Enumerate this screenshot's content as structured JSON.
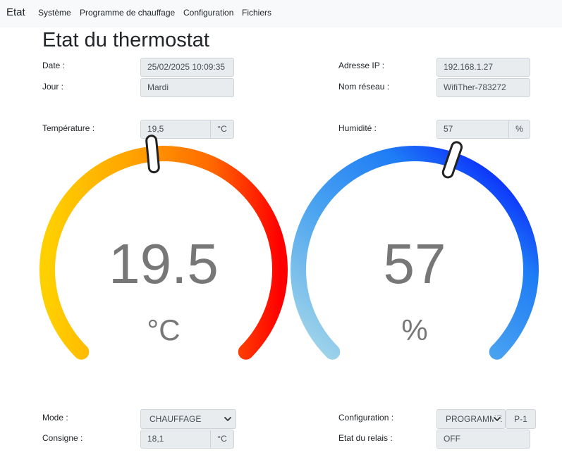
{
  "navbar": {
    "brand": "Etat",
    "items": [
      {
        "label": "Système"
      },
      {
        "label": "Programme de chauffage"
      },
      {
        "label": "Configuration"
      },
      {
        "label": "Fichiers"
      }
    ]
  },
  "page_title": "Etat du thermostat",
  "info": {
    "date_label": "Date :",
    "date_value": "25/02/2025 10:09:35",
    "day_label": "Jour :",
    "day_value": "Mardi",
    "ip_label": "Adresse IP :",
    "ip_value": "192.168.1.27",
    "network_label": "Nom réseau :",
    "network_value": "WifiTher-783272",
    "temperature_label": "Température :",
    "temperature_value": "19,5",
    "temperature_unit": "°C",
    "humidity_label": "Humidité :",
    "humidity_value": "57",
    "humidity_unit": "%"
  },
  "gauges": {
    "temperature": {
      "value_text": "19.5",
      "unit": "°C",
      "value": 19.5,
      "fraction": 0.48,
      "colors": [
        "#ffd000",
        "#ffa500",
        "#ff6a00",
        "#ff0000"
      ]
    },
    "humidity": {
      "value_text": "57",
      "unit": "%",
      "value": 57,
      "fraction": 0.57,
      "colors": [
        "#a9d9e8",
        "#4aa3f0",
        "#1e7cf5",
        "#0000ff"
      ]
    }
  },
  "controls": {
    "mode_label": "Mode :",
    "mode_value": "CHAUFFAGE",
    "setpoint_label": "Consigne :",
    "setpoint_value": "18,1",
    "setpoint_unit": "°C",
    "config_label": "Configuration :",
    "config_value": "PROGRAMME",
    "config_button": "P-1",
    "relay_label": "Etat du relais :",
    "relay_value": "OFF"
  }
}
